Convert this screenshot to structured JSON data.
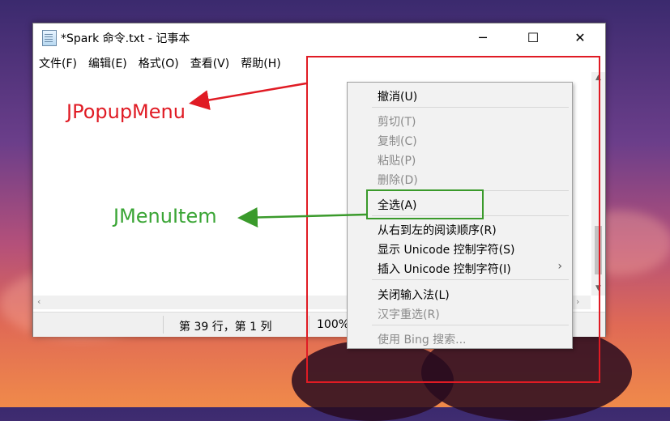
{
  "window": {
    "title": "*Spark 命令.txt - 记事本",
    "minimize_glyph": "─",
    "maximize_glyph": "☐",
    "close_glyph": "✕"
  },
  "menubar": {
    "items": [
      "文件(F)",
      "编辑(E)",
      "格式(O)",
      "查看(V)",
      "帮助(H)"
    ]
  },
  "statusbar": {
    "position": "第 39 行，第 1 列",
    "zoom": "100%"
  },
  "context_menu": {
    "items": [
      {
        "label": "撤消(U)",
        "enabled": true
      },
      {
        "label": "剪切(T)",
        "enabled": false
      },
      {
        "label": "复制(C)",
        "enabled": false
      },
      {
        "label": "粘贴(P)",
        "enabled": false
      },
      {
        "label": "删除(D)",
        "enabled": false
      },
      {
        "label": "全选(A)",
        "enabled": true
      },
      {
        "label": "从右到左的阅读顺序(R)",
        "enabled": true
      },
      {
        "label": "显示 Unicode 控制字符(S)",
        "enabled": true
      },
      {
        "label": "插入 Unicode 控制字符(I)",
        "enabled": true,
        "submenu_arrow": "›"
      },
      {
        "label": "关闭输入法(L)",
        "enabled": true
      },
      {
        "label": "汉字重选(R)",
        "enabled": false
      },
      {
        "label": "使用 Bing 搜索...",
        "enabled": false
      }
    ]
  },
  "annotations": {
    "popup_label": "JPopupMenu",
    "item_label": "JMenuItem",
    "red_color": "#e01b24",
    "green_color": "#3a9a2b"
  }
}
